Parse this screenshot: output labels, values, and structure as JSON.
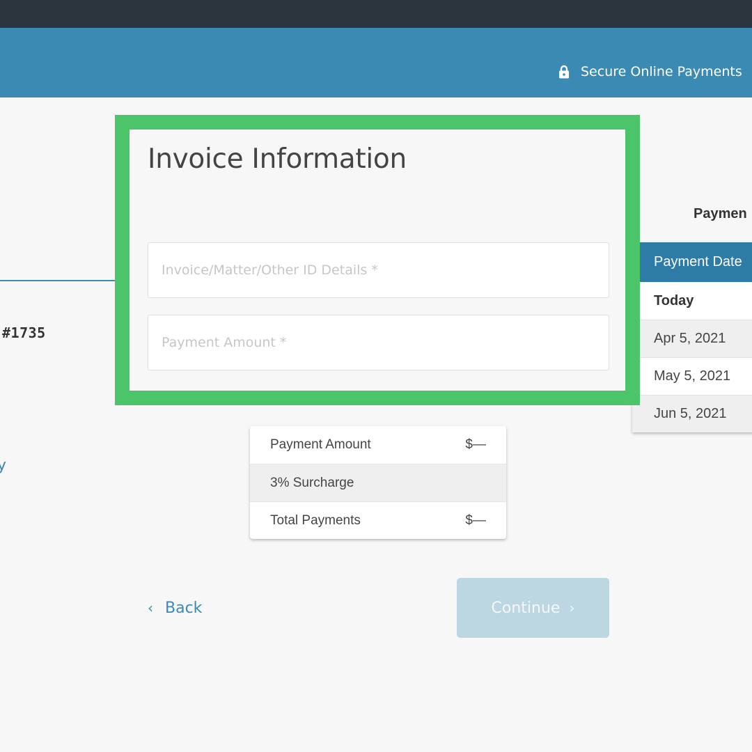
{
  "header": {
    "secure_label": "Secure Online Payments",
    "icon": "lock-icon"
  },
  "left_panel": {
    "order_number": "#1735",
    "link_fragment": "y"
  },
  "invoice": {
    "title": "Invoice Information",
    "invoice_placeholder": "Invoice/Matter/Other ID Details *",
    "amount_placeholder": "Payment Amount *"
  },
  "schedule": {
    "title": "Paymen",
    "header": "Payment Date",
    "dates": [
      "Today",
      "Apr 5, 2021",
      "May 5, 2021",
      "Jun 5, 2021"
    ]
  },
  "summary": {
    "rows": [
      {
        "label": "Payment Amount",
        "value": "$—"
      },
      {
        "label": "3% Surcharge",
        "value": ""
      },
      {
        "label": "Total Payments",
        "value": "$—"
      }
    ]
  },
  "actions": {
    "back_label": "Back",
    "continue_label": "Continue"
  },
  "colors": {
    "header": "#3a8ab4",
    "top_strip": "#29343d",
    "highlight": "#4bc46a",
    "table_header": "#2e7ba8",
    "continue_disabled": "#bcd6e2"
  }
}
